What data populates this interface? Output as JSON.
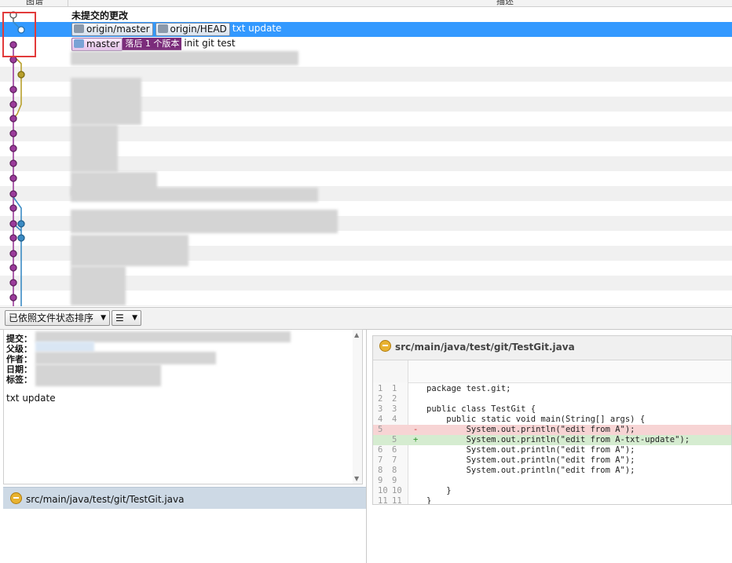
{
  "header": {
    "col_graph": "图谱",
    "col_desc": "描述"
  },
  "commits": [
    {
      "text": "未提交的更改",
      "kind": "uncommitted"
    },
    {
      "tags": [
        "origin/master",
        "origin/HEAD"
      ],
      "text": "txt update",
      "selected": true
    },
    {
      "local_branch": "master",
      "behind_badge": "落后 1 个版本",
      "text": "init git test"
    }
  ],
  "toolbar": {
    "sort_label": "已依照文件状态排序",
    "view_label": "☰"
  },
  "info": {
    "labels": [
      "提交：",
      "父级：",
      "作者：",
      "日期：",
      "标签："
    ],
    "message": "txt update"
  },
  "files": [
    {
      "path": "src/main/java/test/git/TestGit.java"
    }
  ],
  "diff": {
    "file": "src/main/java/test/git/TestGit.java",
    "lines": [
      {
        "old": "1",
        "new": "1",
        "mark": "",
        "code": "package test.git;",
        "type": "ctx"
      },
      {
        "old": "2",
        "new": "2",
        "mark": "",
        "code": "",
        "type": "ctx"
      },
      {
        "old": "3",
        "new": "3",
        "mark": "",
        "code": "public class TestGit {",
        "type": "ctx"
      },
      {
        "old": "4",
        "new": "4",
        "mark": "",
        "code": "    public static void main(String[] args) {",
        "type": "ctx"
      },
      {
        "old": "5",
        "new": "",
        "mark": "-",
        "code": "        System.out.println(\"edit from A\");",
        "type": "del"
      },
      {
        "old": "",
        "new": "5",
        "mark": "+",
        "code": "        System.out.println(\"edit from A-txt-update\");",
        "type": "add"
      },
      {
        "old": "6",
        "new": "6",
        "mark": "",
        "code": "        System.out.println(\"edit from A\");",
        "type": "ctx"
      },
      {
        "old": "7",
        "new": "7",
        "mark": "",
        "code": "        System.out.println(\"edit from A\");",
        "type": "ctx"
      },
      {
        "old": "8",
        "new": "8",
        "mark": "",
        "code": "        System.out.println(\"edit from A\");",
        "type": "ctx"
      },
      {
        "old": "9",
        "new": "9",
        "mark": "",
        "code": "",
        "type": "ctx"
      },
      {
        "old": "10",
        "new": "10",
        "mark": "",
        "code": "    }",
        "type": "ctx"
      },
      {
        "old": "11",
        "new": "11",
        "mark": "",
        "code": "}",
        "type": "ctx"
      }
    ]
  },
  "colors": {
    "selection": "#3399ff",
    "graph_purple": "#9b3b9b",
    "graph_blue": "#3b8bc4",
    "graph_olive": "#b8a02c",
    "highlight_box": "#e23b3b"
  }
}
